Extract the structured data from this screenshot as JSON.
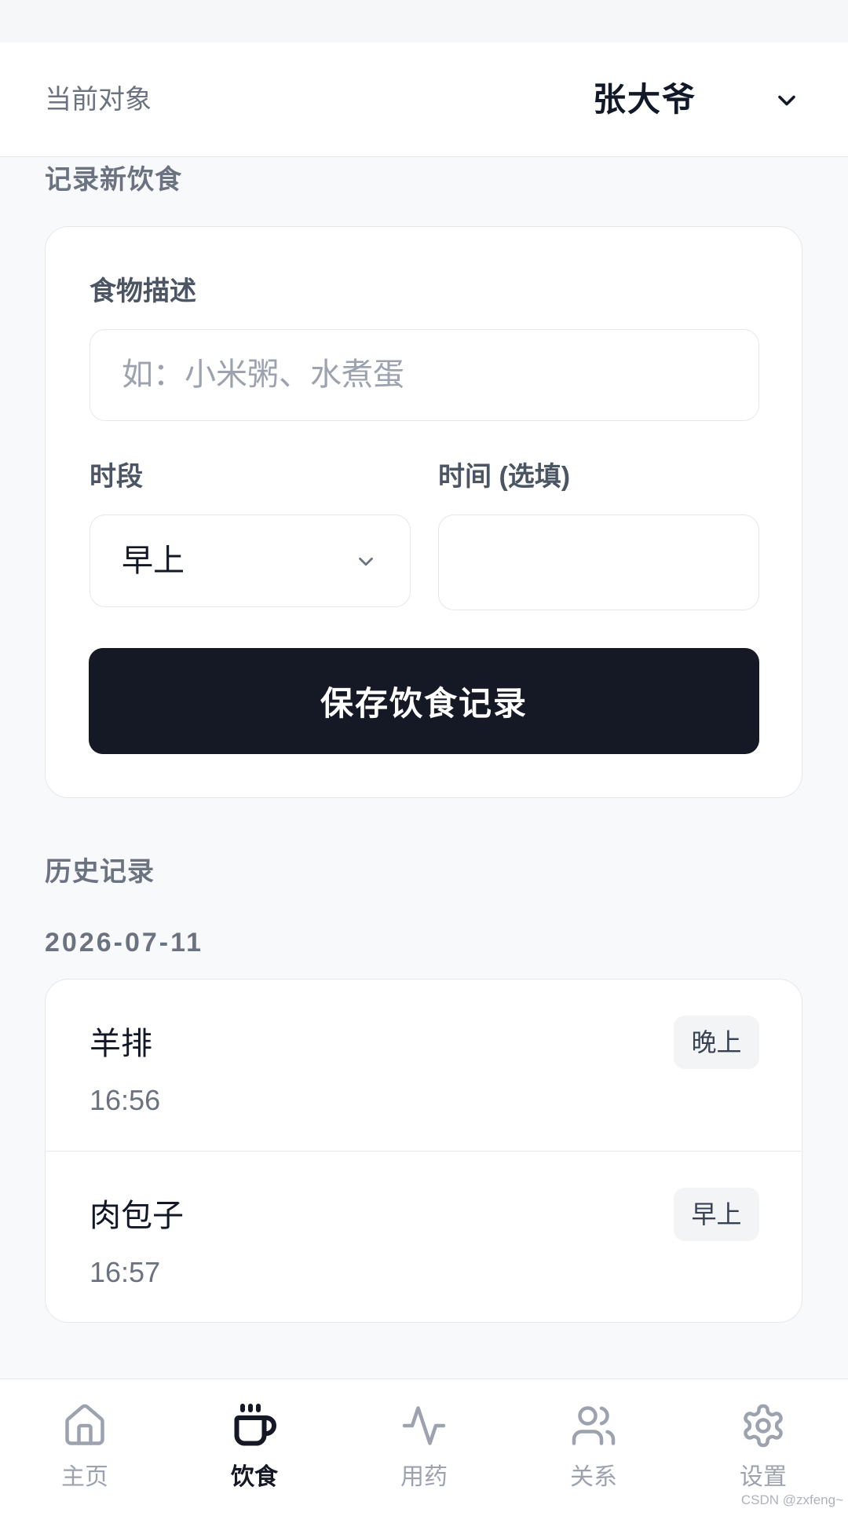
{
  "header": {
    "label": "当前对象",
    "subject": "张大爷"
  },
  "form": {
    "section_title": "记录新饮食",
    "food_label": "食物描述",
    "food_placeholder": "如：小米粥、水煮蛋",
    "period_label": "时段",
    "period_value": "早上",
    "time_label": "时间 (选填)",
    "save_label": "保存饮食记录"
  },
  "history": {
    "section_title": "历史记录",
    "groups": [
      {
        "date": "2026-07-11",
        "entries": [
          {
            "food": "羊排",
            "time": "16:56",
            "period": "晚上"
          },
          {
            "food": "肉包子",
            "time": "16:57",
            "period": "早上"
          }
        ]
      }
    ]
  },
  "nav": {
    "items": [
      {
        "label": "主页",
        "icon": "home-icon",
        "active": false
      },
      {
        "label": "饮食",
        "icon": "coffee-cup-icon",
        "active": true
      },
      {
        "label": "用药",
        "icon": "activity-icon",
        "active": false
      },
      {
        "label": "关系",
        "icon": "users-icon",
        "active": false
      },
      {
        "label": "设置",
        "icon": "settings-icon",
        "active": false
      }
    ]
  },
  "watermark": "CSDN @zxfeng~",
  "colors": {
    "accent": "#141925",
    "muted": "#9ca3af"
  }
}
